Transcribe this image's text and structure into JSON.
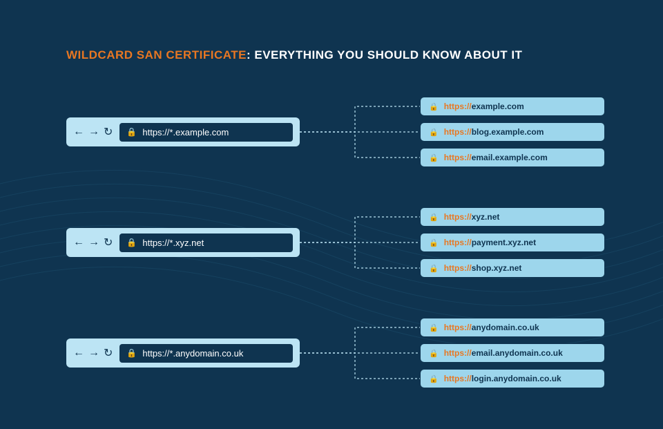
{
  "title": {
    "highlight": "WILDCARD SAN CERTIFICATE",
    "rest": ": EVERYTHING YOU SHOULD KNOW ABOUT IT"
  },
  "rows": [
    {
      "wildcard": "https://*.example.com",
      "targets": [
        {
          "proto": "https://",
          "domain": "example.com"
        },
        {
          "proto": "https://",
          "domain": "blog.example.com"
        },
        {
          "proto": "https://",
          "domain": "email.example.com"
        }
      ]
    },
    {
      "wildcard": "https://*.xyz.net",
      "targets": [
        {
          "proto": "https://",
          "domain": "xyz.net"
        },
        {
          "proto": "https://",
          "domain": "payment.xyz.net"
        },
        {
          "proto": "https://",
          "domain": "shop.xyz.net"
        }
      ]
    },
    {
      "wildcard": "https://*.anydomain.co.uk",
      "targets": [
        {
          "proto": "https://",
          "domain": "anydomain.co.uk"
        },
        {
          "proto": "https://",
          "domain": "email.anydomain.co.uk"
        },
        {
          "proto": "https://",
          "domain": "login.anydomain.co.uk"
        }
      ]
    }
  ]
}
